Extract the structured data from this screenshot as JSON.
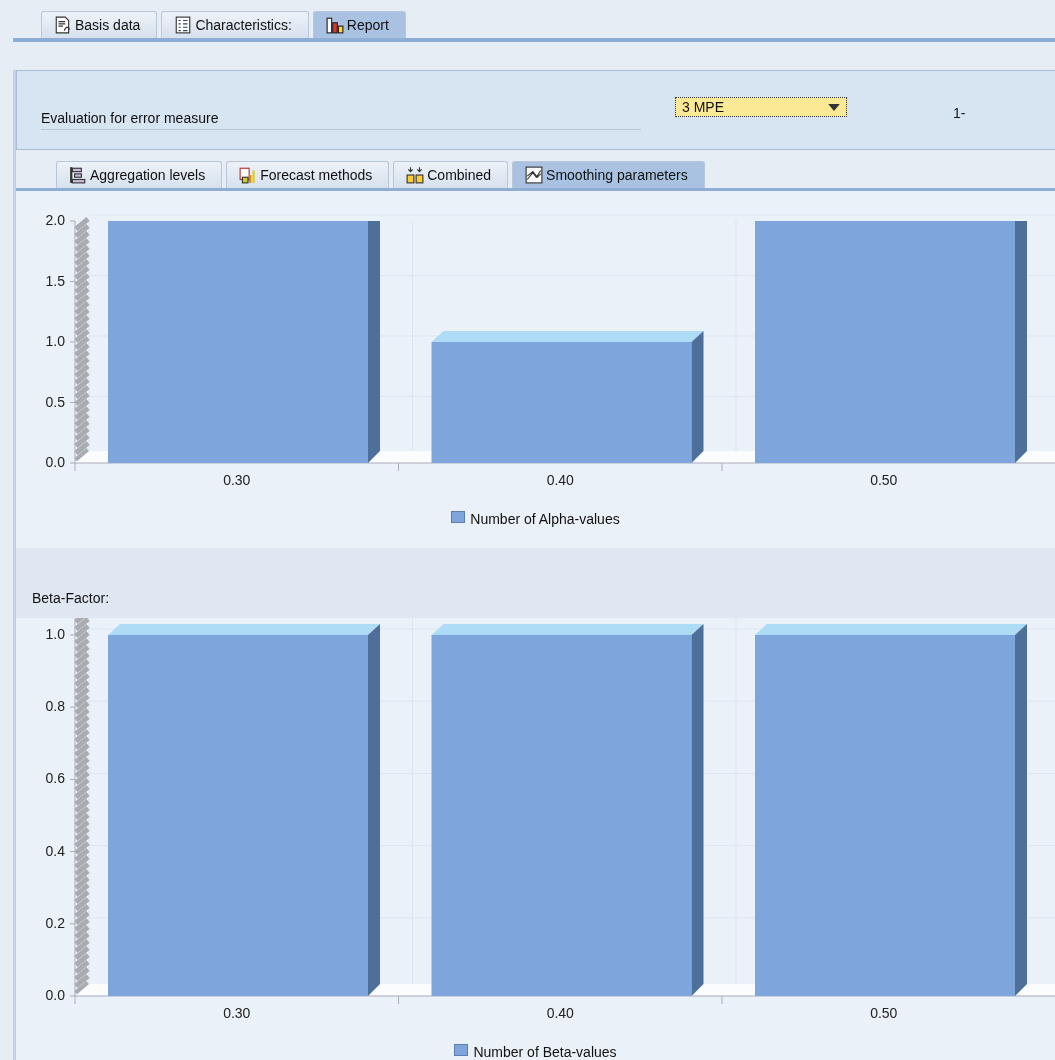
{
  "main_tabs": [
    {
      "label": "Basis data",
      "selected": false
    },
    {
      "label": "Characteristics:",
      "selected": false
    },
    {
      "label": "Report",
      "selected": true
    }
  ],
  "evaluation": {
    "label": "Evaluation for error measure",
    "value": "3 MPE",
    "result": "1-"
  },
  "sub_tabs": [
    {
      "label": "Aggregation levels",
      "selected": false
    },
    {
      "label": "Forecast methods",
      "selected": false
    },
    {
      "label": "Combined",
      "selected": false
    },
    {
      "label": "Smoothing parameters",
      "selected": true
    }
  ],
  "alpha_chart": {
    "chart_data": {
      "type": "bar",
      "categories": [
        "0.30",
        "0.40",
        "0.50"
      ],
      "series": [
        {
          "name": "Number of Alpha-values",
          "color": "#7ea6dc",
          "values": [
            2,
            1,
            2
          ]
        }
      ],
      "ylim": [
        0,
        2
      ],
      "yticks": [
        {
          "value": 0,
          "label": "0.0"
        },
        {
          "value": 0.5,
          "label": "0.5"
        },
        {
          "value": 1,
          "label": "1.0"
        },
        {
          "value": 1.5,
          "label": "1.5"
        },
        {
          "value": 2,
          "label": "2.0"
        }
      ]
    }
  },
  "beta_chart": {
    "title": "Beta-Factor:",
    "chart_data": {
      "type": "bar",
      "categories": [
        "0.30",
        "0.40",
        "0.50"
      ],
      "series": [
        {
          "name": "Number of Beta-values",
          "color": "#7ea6dc",
          "values": [
            1,
            1,
            1
          ]
        }
      ],
      "ylim": [
        0,
        1
      ],
      "yticks": [
        {
          "value": 0,
          "label": "0.0"
        },
        {
          "value": 0.2,
          "label": "0.2"
        },
        {
          "value": 0.4,
          "label": "0.4"
        },
        {
          "value": 0.6,
          "label": "0.6"
        },
        {
          "value": 0.8,
          "label": "0.8"
        },
        {
          "value": 1,
          "label": "1.0"
        }
      ]
    }
  }
}
